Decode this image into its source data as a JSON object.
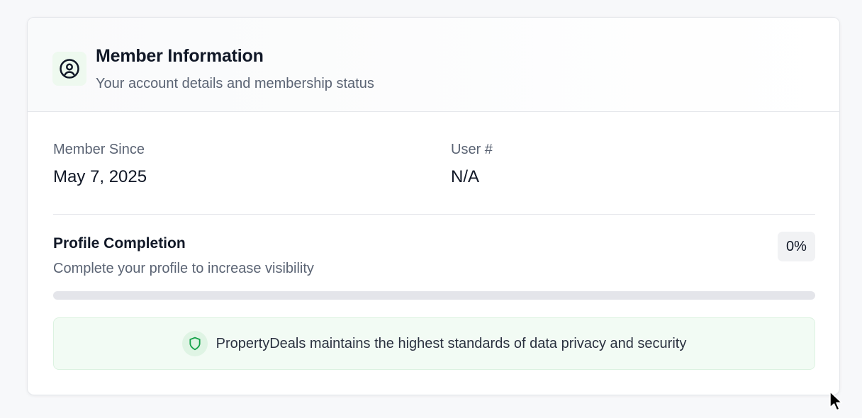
{
  "header": {
    "title": "Member Information",
    "subtitle": "Your account details and membership status",
    "icon": "user-circle-icon"
  },
  "info": {
    "member_since_label": "Member Since",
    "member_since_value": "May 7, 2025",
    "user_number_label": "User #",
    "user_number_value": "N/A"
  },
  "profile_completion": {
    "title": "Profile Completion",
    "subtitle": "Complete your profile to increase visibility",
    "percent_label": "0%",
    "progress_fraction": 0
  },
  "privacy_notice": {
    "icon": "shield-icon",
    "text": "PropertyDeals maintains the highest standards of data privacy and security"
  },
  "colors": {
    "accent_green": "#16a34a",
    "icon_bg_green": "#eef9ef",
    "notice_bg": "#f2fbf4",
    "progress_track": "#e4e5ea"
  }
}
